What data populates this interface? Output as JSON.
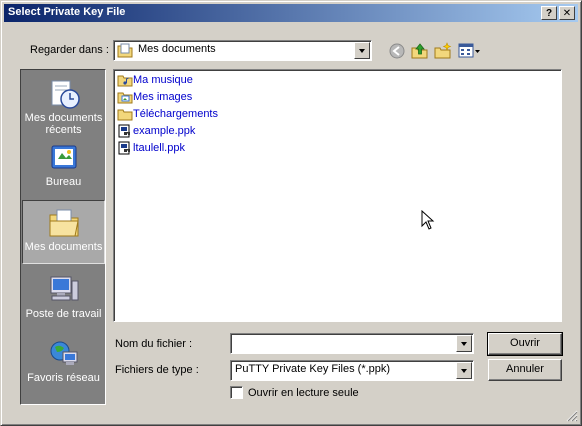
{
  "window": {
    "title": "Select Private Key File",
    "help_label": "?",
    "close_label": "✕"
  },
  "lookin": {
    "label": "Regarder dans :",
    "value": "Mes documents"
  },
  "places": [
    {
      "label": "Mes documents récents",
      "icon": "recent-documents-icon"
    },
    {
      "label": "Bureau",
      "icon": "desktop-icon"
    },
    {
      "label": "Mes documents",
      "icon": "my-documents-icon",
      "selected": true
    },
    {
      "label": "Poste de travail",
      "icon": "my-computer-icon"
    },
    {
      "label": "Favoris réseau",
      "icon": "network-places-icon"
    }
  ],
  "files": [
    {
      "name": "Ma musique",
      "type": "folder"
    },
    {
      "name": "Mes images",
      "type": "folder"
    },
    {
      "name": "Téléchargements",
      "type": "folder"
    },
    {
      "name": "example.ppk",
      "type": "ppk"
    },
    {
      "name": "ltaulell.ppk",
      "type": "ppk"
    }
  ],
  "filename": {
    "label": "Nom du fichier :",
    "value": ""
  },
  "filetype": {
    "label": "Fichiers de type :",
    "value": "PuTTY Private Key Files (*.ppk)"
  },
  "buttons": {
    "open": "Ouvrir",
    "cancel": "Annuler"
  },
  "readonly": {
    "label": "Ouvrir en lecture seule",
    "checked": false
  },
  "colors": {
    "title_start": "#0a246a",
    "title_end": "#a6caf0",
    "face": "#d4d0c8",
    "link_text": "#0000cc"
  }
}
